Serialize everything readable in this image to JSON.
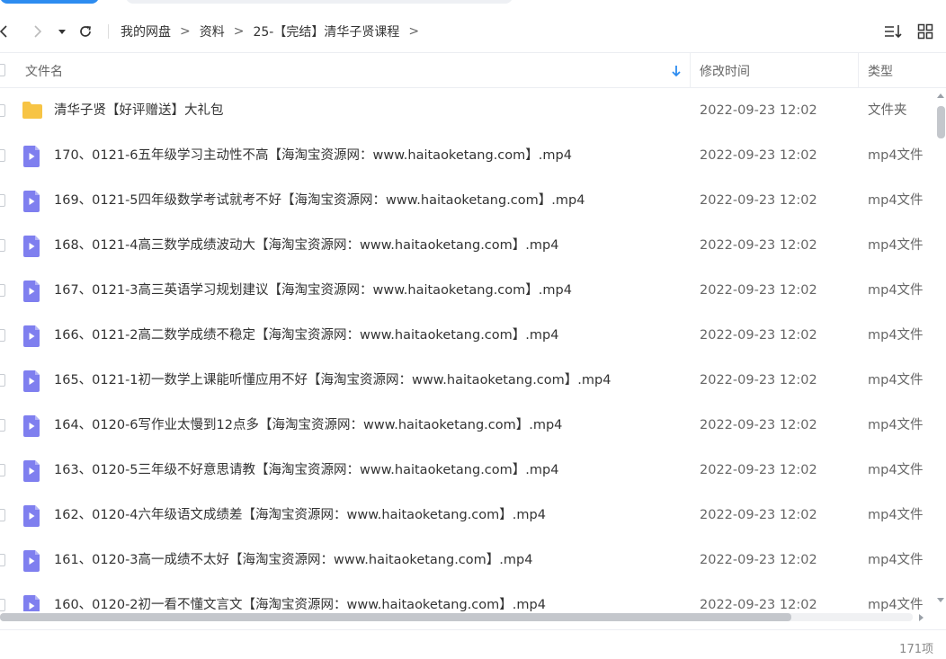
{
  "breadcrumb": {
    "items": [
      "我的网盘",
      "资料",
      "25-【完结】清华子贤课程"
    ],
    "separator": ">"
  },
  "header": {
    "name_label": "文件名",
    "date_label": "修改时间",
    "type_label": "类型"
  },
  "files": [
    {
      "name": "清华子贤【好评赠送】大礼包",
      "date": "2022-09-23 12:02",
      "type": "文件夹",
      "icon": "folder-icon"
    },
    {
      "name": "170、0121-6五年级学习主动性不高【海淘宝资源网：www.haitaoketang.com】.mp4",
      "date": "2022-09-23 12:02",
      "type": "mp4文件",
      "icon": "video-file-icon"
    },
    {
      "name": "169、0121-5四年级数学考试就考不好【海淘宝资源网：www.haitaoketang.com】.mp4",
      "date": "2022-09-23 12:02",
      "type": "mp4文件",
      "icon": "video-file-icon"
    },
    {
      "name": "168、0121-4高三数学成绩波动大【海淘宝资源网：www.haitaoketang.com】.mp4",
      "date": "2022-09-23 12:02",
      "type": "mp4文件",
      "icon": "video-file-icon"
    },
    {
      "name": "167、0121-3高三英语学习规划建议【海淘宝资源网：www.haitaoketang.com】.mp4",
      "date": "2022-09-23 12:02",
      "type": "mp4文件",
      "icon": "video-file-icon"
    },
    {
      "name": "166、0121-2高二数学成绩不稳定【海淘宝资源网：www.haitaoketang.com】.mp4",
      "date": "2022-09-23 12:02",
      "type": "mp4文件",
      "icon": "video-file-icon"
    },
    {
      "name": "165、0121-1初一数学上课能听懂应用不好【海淘宝资源网：www.haitaoketang.com】.mp4",
      "date": "2022-09-23 12:02",
      "type": "mp4文件",
      "icon": "video-file-icon"
    },
    {
      "name": "164、0120-6写作业太慢到12点多【海淘宝资源网：www.haitaoketang.com】.mp4",
      "date": "2022-09-23 12:02",
      "type": "mp4文件",
      "icon": "video-file-icon"
    },
    {
      "name": "163、0120-5三年级不好意思请教【海淘宝资源网：www.haitaoketang.com】.mp4",
      "date": "2022-09-23 12:02",
      "type": "mp4文件",
      "icon": "video-file-icon"
    },
    {
      "name": "162、0120-4六年级语文成绩差【海淘宝资源网：www.haitaoketang.com】.mp4",
      "date": "2022-09-23 12:02",
      "type": "mp4文件",
      "icon": "video-file-icon"
    },
    {
      "name": "161、0120-3高一成绩不太好【海淘宝资源网：www.haitaoketang.com】.mp4",
      "date": "2022-09-23 12:02",
      "type": "mp4文件",
      "icon": "video-file-icon"
    },
    {
      "name": "160、0120-2初一看不懂文言文【海淘宝资源网：www.haitaoketang.com】.mp4",
      "date": "2022-09-23 12:02",
      "type": "mp4文件",
      "icon": "video-file-icon"
    }
  ],
  "footer": {
    "count": "171项"
  },
  "colors": {
    "accent": "#2d8cf0",
    "folder": "#f7c445",
    "video": "#7f7fef"
  }
}
